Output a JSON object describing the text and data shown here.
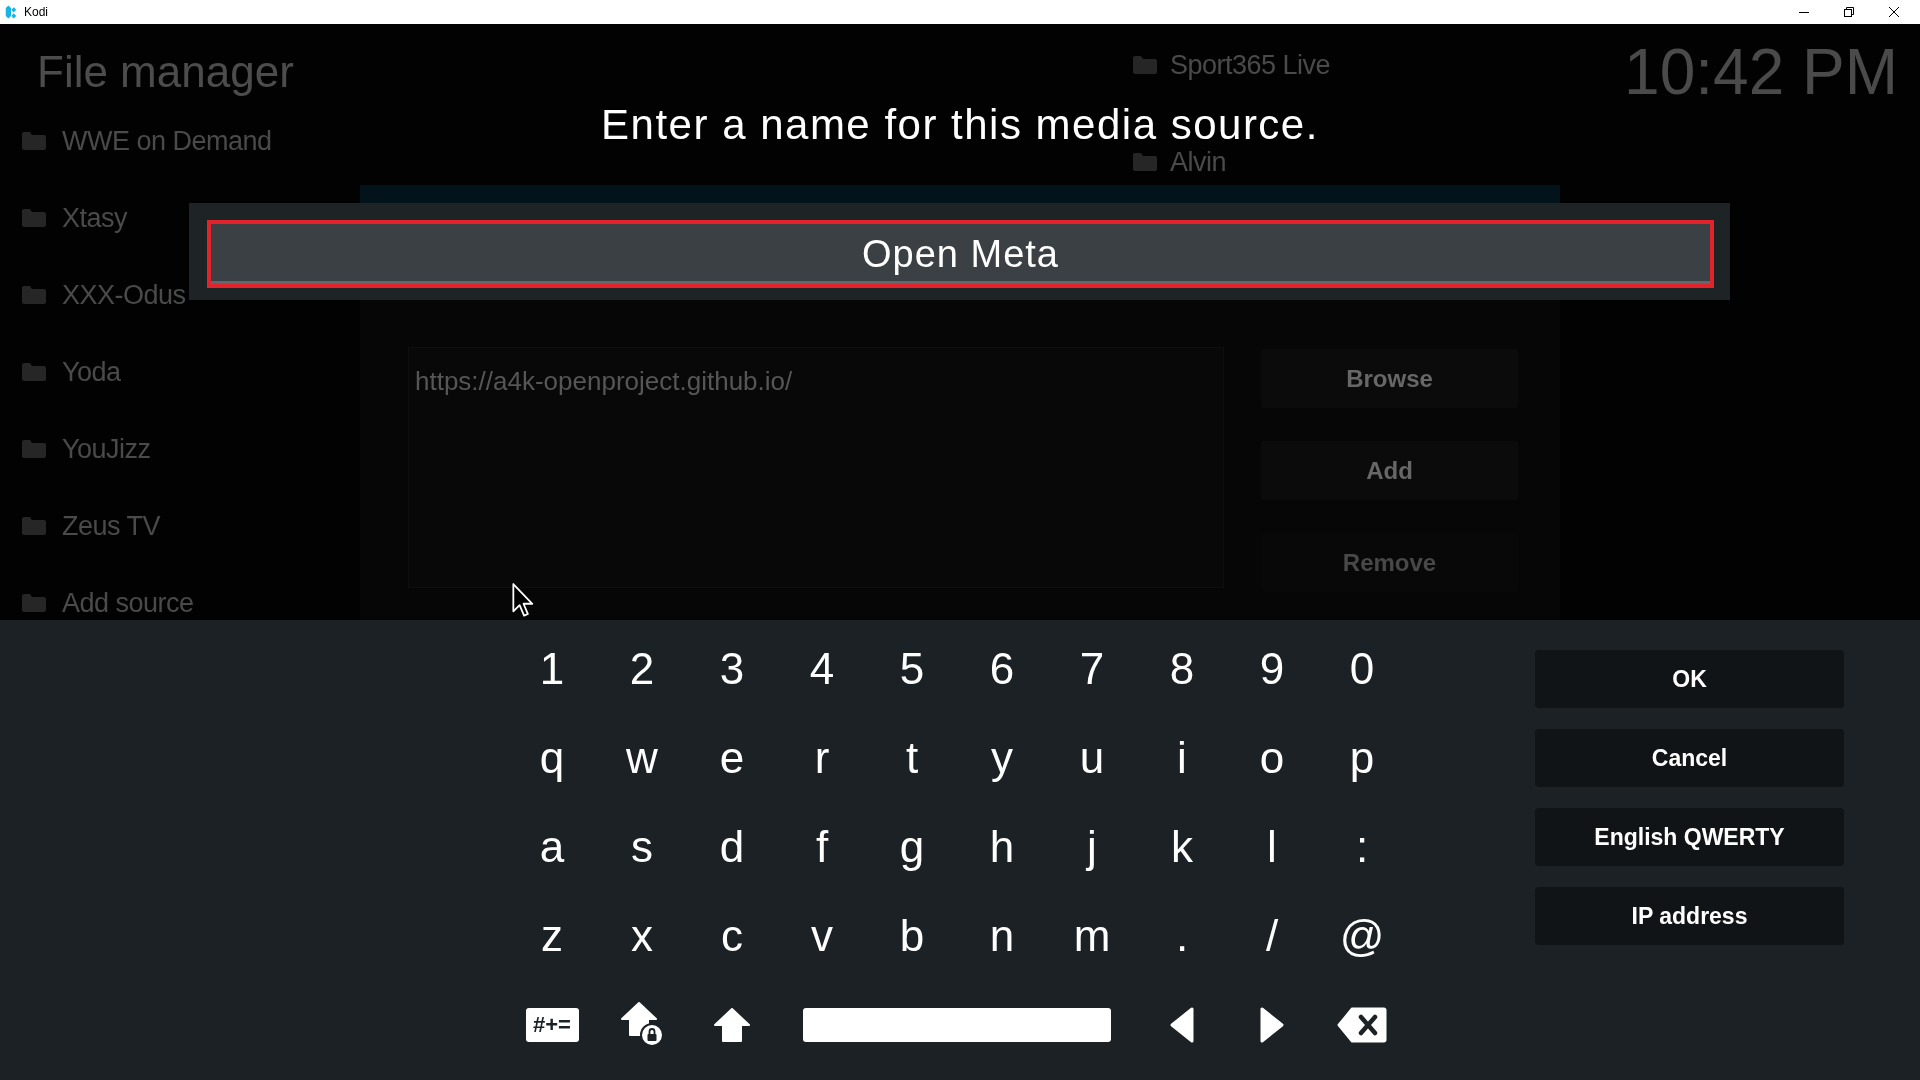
{
  "window": {
    "title": "Kodi"
  },
  "background": {
    "title": "File manager",
    "sources": [
      "WWE on Demand",
      "Xtasy",
      "XXX-Odus",
      "Yoda",
      "YouJizz",
      "Zeus TV",
      "Add source"
    ],
    "top_sources": [
      "Sport365 Live",
      "Alvin"
    ],
    "clock": "10:42 PM",
    "source_dialog": {
      "path": "https://a4k-openproject.github.io/",
      "buttons": [
        {
          "label": "Browse",
          "disabled": false
        },
        {
          "label": "Add",
          "disabled": false
        },
        {
          "label": "Remove",
          "disabled": true
        }
      ]
    }
  },
  "dialog": {
    "heading": "Enter a name for this media source.",
    "value": "Open Meta"
  },
  "keyboard": {
    "rows": [
      [
        "1",
        "2",
        "3",
        "4",
        "5",
        "6",
        "7",
        "8",
        "9",
        "0"
      ],
      [
        "q",
        "w",
        "e",
        "r",
        "t",
        "y",
        "u",
        "i",
        "o",
        "p"
      ],
      [
        "a",
        "s",
        "d",
        "f",
        "g",
        "h",
        "j",
        "k",
        "l",
        ":"
      ],
      [
        "z",
        "x",
        "c",
        "v",
        "b",
        "n",
        "m",
        ".",
        "/",
        "@"
      ]
    ],
    "bottom_row": [
      {
        "kind": "symbols",
        "label": "#+="
      },
      {
        "kind": "caps_lock"
      },
      {
        "kind": "shift"
      },
      {
        "kind": "space"
      },
      {
        "kind": "left"
      },
      {
        "kind": "right"
      },
      {
        "kind": "backspace"
      }
    ]
  },
  "buttons": [
    "OK",
    "Cancel",
    "English QWERTY",
    "IP address"
  ]
}
